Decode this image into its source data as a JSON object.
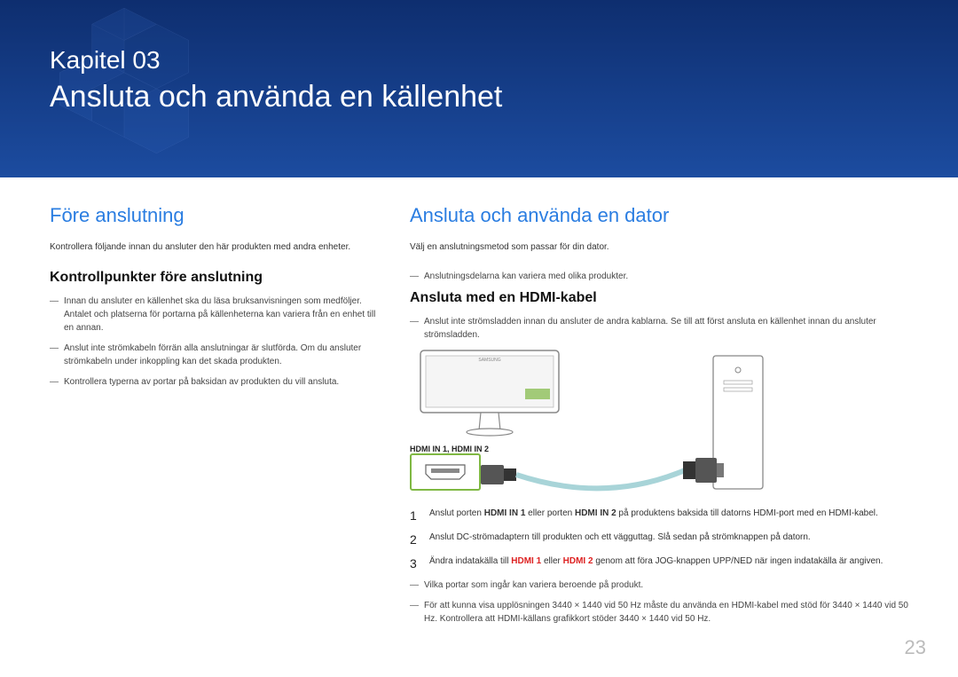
{
  "chapter": {
    "label": "Kapitel 03",
    "title": "Ansluta och använda en källenhet"
  },
  "left": {
    "heading": "Före anslutning",
    "intro": "Kontrollera följande innan du ansluter den här produkten med andra enheter.",
    "subheading": "Kontrollpunkter före anslutning",
    "bullets": [
      "Innan du ansluter en källenhet ska du läsa bruksanvisningen som medföljer. Antalet och platserna för portarna på källenheterna kan variera från en enhet till en annan.",
      "Anslut inte strömkabeln förrän alla anslutningar är slutförda. Om du ansluter strömkabeln under inkoppling kan det skada produkten.",
      "Kontrollera typerna av portar på baksidan av produkten du vill ansluta."
    ]
  },
  "right": {
    "heading": "Ansluta och använda en dator",
    "intro": "Välj en anslutningsmetod som passar för din dator.",
    "note1": "Anslutningsdelarna kan variera med olika produkter.",
    "subheading": "Ansluta med en HDMI-kabel",
    "hdmi_note": "Anslut inte strömsladden innan du ansluter de andra kablarna. Se till att först ansluta en källenhet innan du ansluter strömsladden.",
    "hdmi_label": "HDMI IN 1, HDMI IN 2",
    "steps": {
      "1": {
        "pre": "Anslut porten ",
        "b1": "HDMI IN 1",
        "mid": " eller porten ",
        "b2": "HDMI IN 2",
        "post": " på produktens baksida till datorns HDMI-port med en HDMI-kabel."
      },
      "2": "Anslut DC-strömadaptern till produkten och ett vägguttag. Slå sedan på strömknappen på datorn.",
      "3": {
        "pre": "Ändra indatakälla till ",
        "r1": "HDMI 1",
        "mid": " eller ",
        "r2": "HDMI 2",
        "post": " genom att föra JOG-knappen UPP/NED när ingen indatakälla är angiven."
      }
    },
    "footnotes": [
      "Vilka portar som ingår kan variera beroende på produkt.",
      "För att kunna visa upplösningen 3440 × 1440 vid 50 Hz måste du använda en HDMI-kabel med stöd för 3440 × 1440 vid 50 Hz. Kontrollera att HDMI-källans grafikkort stöder 3440 × 1440 vid 50 Hz."
    ]
  },
  "page_number": "23"
}
